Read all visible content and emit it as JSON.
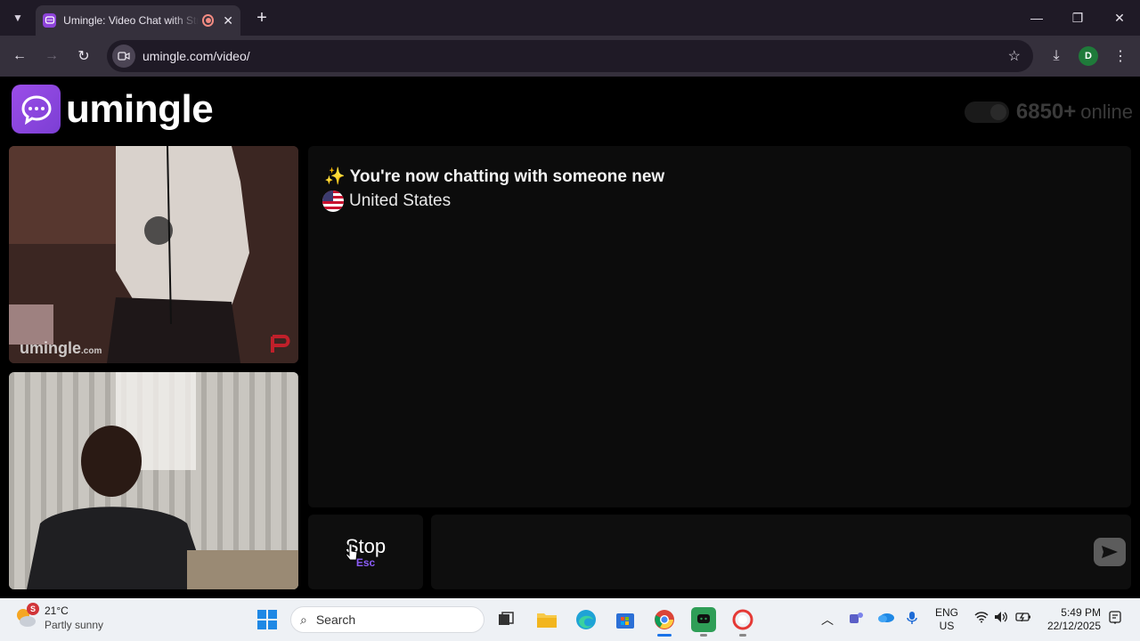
{
  "browser": {
    "tab_title": "Umingle: Video Chat with Strangers",
    "url": "umingle.com/video/",
    "profile_initial": "D"
  },
  "header": {
    "logo_text": "umingle",
    "online_count": "6850+",
    "online_label": "online"
  },
  "videos": {
    "watermark_main": "umingle",
    "watermark_suffix": ".com"
  },
  "chat": {
    "headline_icon": "✨",
    "headline": "You're now chatting with someone new",
    "country": "United States"
  },
  "controls": {
    "stop_label": "Stop",
    "stop_key": "Esc",
    "message_placeholder": "",
    "send_icon": "send-icon"
  },
  "taskbar": {
    "weather_temp": "21°C",
    "weather_desc": "Partly sunny",
    "weather_badge": "S",
    "search_placeholder": "Search",
    "lang_top": "ENG",
    "lang_bottom": "US",
    "time": "5:49 PM",
    "date": "22/12/2025"
  },
  "colors": {
    "accent": "#8b5cf6",
    "logo_gradient": "#9b4de8",
    "chrome_bg": "#35303c"
  }
}
